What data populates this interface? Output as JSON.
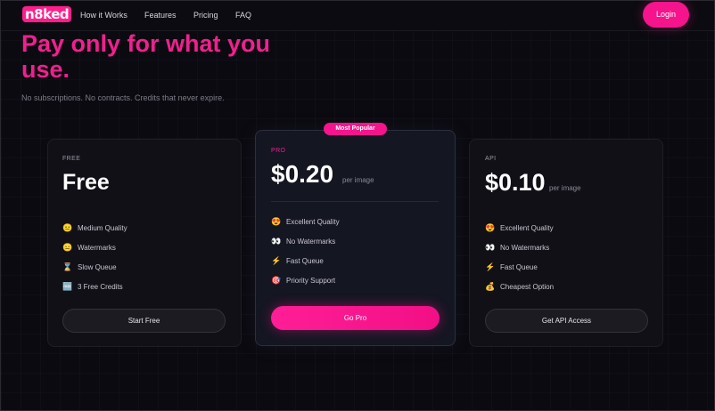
{
  "nav": {
    "logo": "n8ked",
    "links": [
      "How it Works",
      "Features",
      "Pricing",
      "FAQ"
    ],
    "login": "Login"
  },
  "hero": {
    "title": "Pay only for what you use.",
    "subtitle": "No subscriptions. No contracts. Credits that never expire."
  },
  "plans": {
    "free": {
      "tag": "FREE",
      "price": "Free",
      "features": [
        {
          "icon": "😐",
          "text": "Medium Quality"
        },
        {
          "icon": "😑",
          "text": "Watermarks"
        },
        {
          "icon": "⌛",
          "text": "Slow Queue"
        },
        {
          "icon": "🆓",
          "text": "3 Free Credits"
        }
      ],
      "button": "Start Free"
    },
    "pro": {
      "badge": "Most Popular",
      "tag": "PRO",
      "price": "$0.20",
      "per": "per image",
      "features": [
        {
          "icon": "😍",
          "text": "Excellent Quality"
        },
        {
          "icon": "👀",
          "text": "No Watermarks"
        },
        {
          "icon": "⚡",
          "text": "Fast Queue"
        },
        {
          "icon": "🎯",
          "text": "Priority Support"
        }
      ],
      "button": "Go Pro"
    },
    "api": {
      "tag": "API",
      "price": "$0.10",
      "per": "per image",
      "features": [
        {
          "icon": "😍",
          "text": "Excellent Quality"
        },
        {
          "icon": "👀",
          "text": "No Watermarks"
        },
        {
          "icon": "⚡",
          "text": "Fast Queue"
        },
        {
          "icon": "💰",
          "text": "Cheapest Option"
        }
      ],
      "button": "Get API Access"
    }
  }
}
